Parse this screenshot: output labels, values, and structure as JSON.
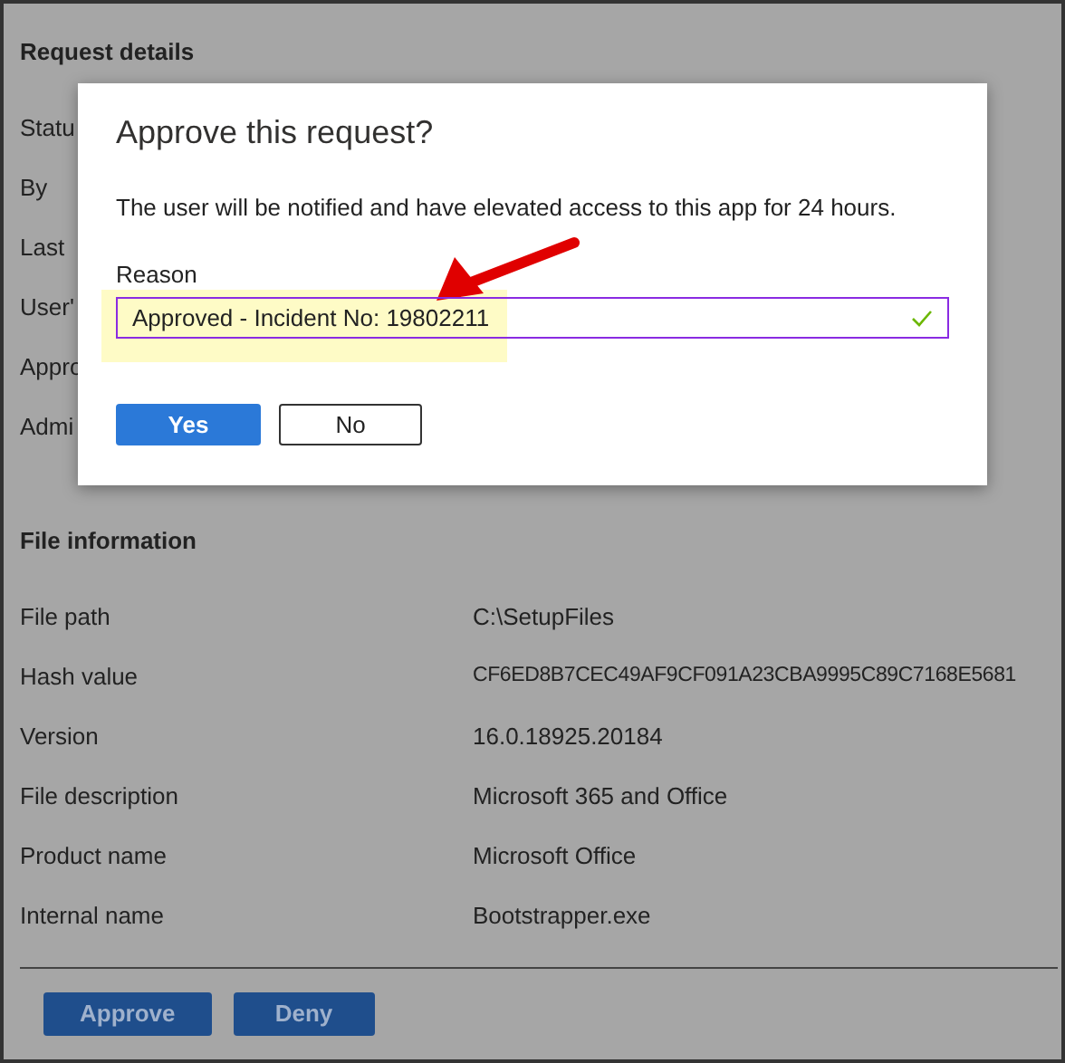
{
  "page": {
    "sections": [
      {
        "title": "Request details",
        "rows": [
          {
            "label": "Statu"
          },
          {
            "label": "By"
          },
          {
            "label": "Last"
          },
          {
            "label": "User'"
          },
          {
            "label": "Appro"
          },
          {
            "label": "Admi"
          }
        ]
      },
      {
        "title": "File information",
        "rows": [
          {
            "label": "File path",
            "value": "C:\\SetupFiles"
          },
          {
            "label": "Hash value",
            "value": "CF6ED8B7CEC49AF9CF091A23CBA9995C89C7168E5681"
          },
          {
            "label": "Version",
            "value": "16.0.18925.20184"
          },
          {
            "label": "File description",
            "value": "Microsoft 365 and Office"
          },
          {
            "label": "Product name",
            "value": "Microsoft Office"
          },
          {
            "label": "Internal name",
            "value": "Bootstrapper.exe"
          }
        ]
      }
    ],
    "buttons": [
      {
        "label": "Approve"
      },
      {
        "label": "Deny"
      }
    ]
  },
  "dialog": {
    "title": "Approve this request?",
    "message": "The user will be notified and have elevated access to this app for 24 hours.",
    "field": {
      "label": "Reason",
      "value": "Approved - Incident No: 19802211",
      "valid": true
    },
    "buttons": [
      {
        "label": "Yes",
        "primary": true
      },
      {
        "label": "No",
        "primary": false
      }
    ]
  }
}
